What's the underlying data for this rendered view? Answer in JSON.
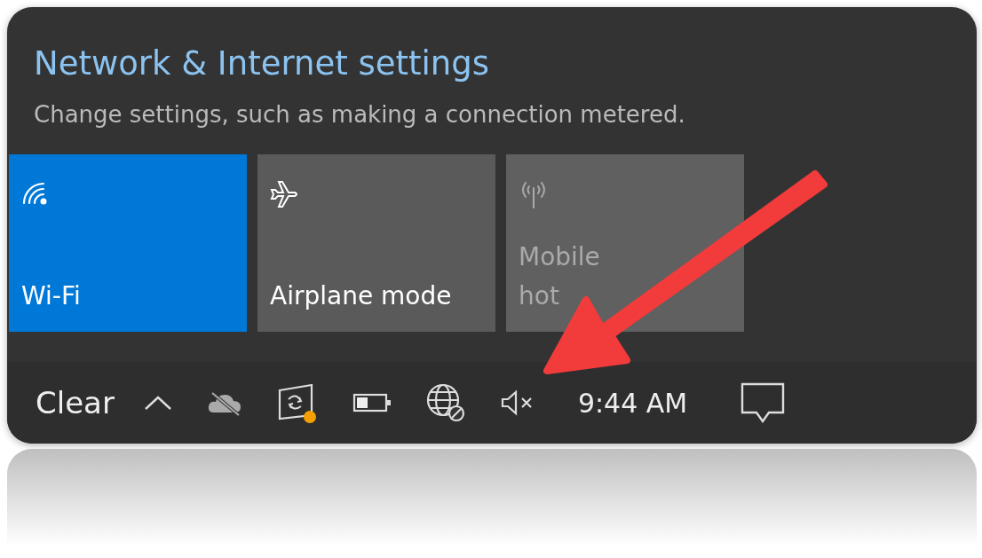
{
  "flyout": {
    "title": "Network & Internet settings",
    "subtitle": "Change settings, such as making a connection metered."
  },
  "tiles": [
    {
      "kind": "wifi",
      "label": "Wi-Fi",
      "on": true,
      "disabled": false
    },
    {
      "kind": "airplane",
      "label": "Airplane mode",
      "on": false,
      "disabled": false
    },
    {
      "kind": "hotspot",
      "label": "Mobile hot",
      "on": false,
      "disabled": true
    }
  ],
  "taskbar": {
    "weather": "Clear",
    "clock": "9:44 AM",
    "update_badge": true
  }
}
